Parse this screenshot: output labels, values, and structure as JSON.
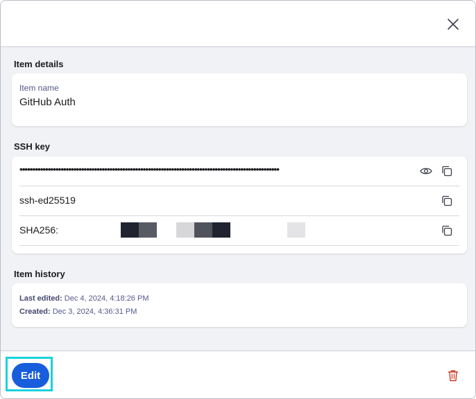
{
  "header": {
    "close_icon": "close-icon"
  },
  "item_details": {
    "title": "Item details",
    "name_label": "Item name",
    "name_value": "GitHub Auth"
  },
  "ssh_key": {
    "title": "SSH key",
    "private_key_masked": "•••••••••••••••••••••••••••••••••••••••••••••••••••••••••••••••••••••••••••••••••••••••••••••••••••••",
    "key_type": "ssh-ed25519",
    "fingerprint_prefix": "SHA256:",
    "icons": {
      "reveal": "eye-icon",
      "copy": "copy-icon"
    }
  },
  "item_history": {
    "title": "Item history",
    "last_edited_label": "Last edited:",
    "last_edited_value": "Dec 4, 2024, 4:18:26 PM",
    "created_label": "Created:",
    "created_value": "Dec 3, 2024, 4:36:31 PM"
  },
  "footer": {
    "edit_label": "Edit",
    "delete_icon": "trash-icon"
  },
  "colors": {
    "primary": "#175ddc",
    "highlight": "#1ad1dd",
    "danger": "#c83522",
    "muted_text": "#52598a"
  }
}
